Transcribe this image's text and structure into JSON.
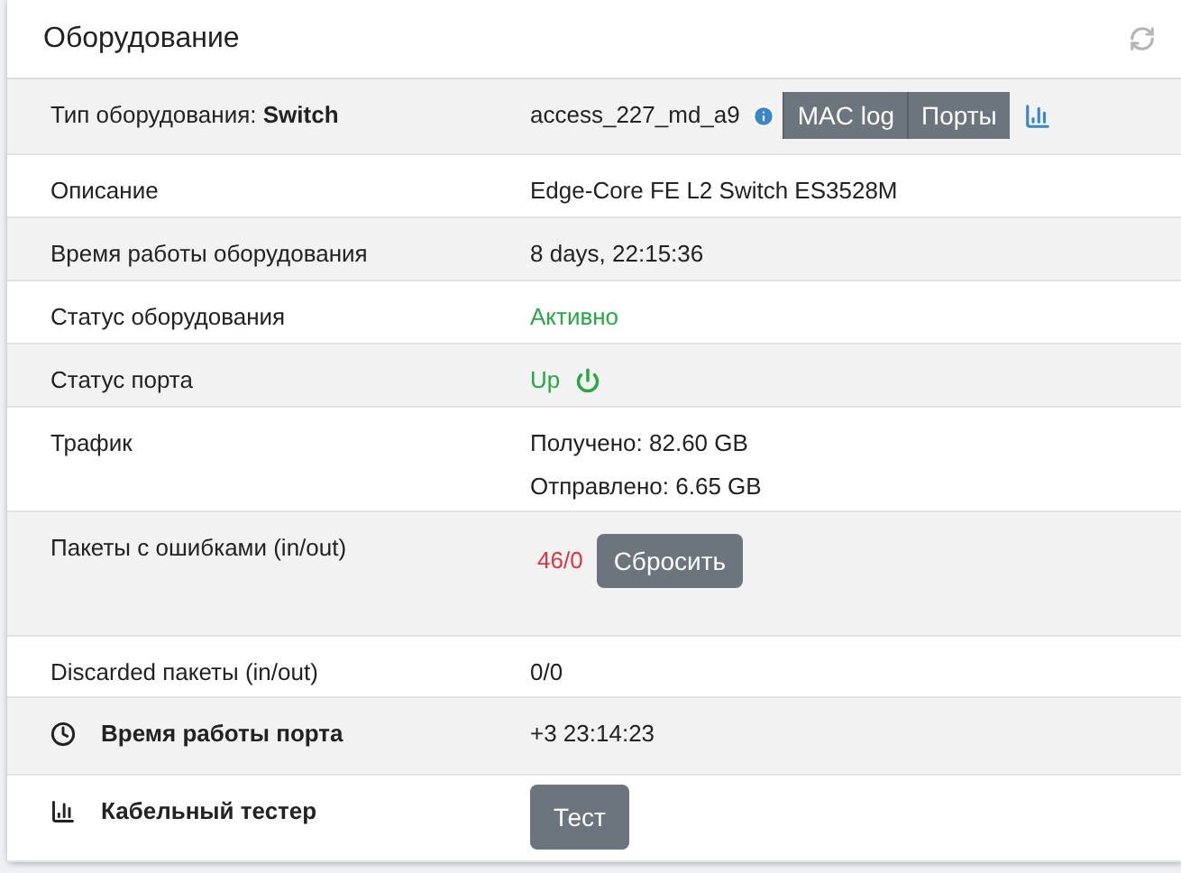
{
  "title": "Оборудование",
  "rows": [
    {
      "label": "Тип оборудования: **Switch**",
      "value": {
        "kind": "device",
        "text": "access_227_md_a9",
        "buttons": [
          "MAC log",
          "Порты"
        ]
      }
    },
    {
      "label": "Описание",
      "value": {
        "kind": "text",
        "text": "Edge-Core FE L2 Switch ES3528M"
      }
    },
    {
      "label": "Время работы оборудования",
      "value": {
        "kind": "text",
        "text": "8 days, 22:15:36"
      }
    },
    {
      "label": "Статус оборудования",
      "value": {
        "kind": "status",
        "text": "Активно"
      }
    },
    {
      "label": "Статус порта",
      "value": {
        "kind": "port",
        "text": "Up"
      }
    },
    {
      "label": "Трафик",
      "value": {
        "kind": "lines",
        "lines": [
          "Получено: 82.60 GB",
          "Отправлено: 6.65 GB"
        ]
      }
    },
    {
      "label": "Пакеты с ошибками (in/out)",
      "value": {
        "kind": "errors",
        "text": "46/0",
        "button": "Сбросить"
      }
    },
    {
      "label": "Discarded пакеты (in/out)",
      "value": {
        "kind": "text",
        "text": "0/0"
      }
    },
    {
      "label": "Время работы порта",
      "kind": "heading",
      "value": {
        "kind": "text",
        "text": "+3 23:14:23"
      }
    },
    {
      "label": "Кабельный тестер",
      "kind": "heading",
      "value": {
        "kind": "button",
        "button": "Тест"
      }
    }
  ]
}
